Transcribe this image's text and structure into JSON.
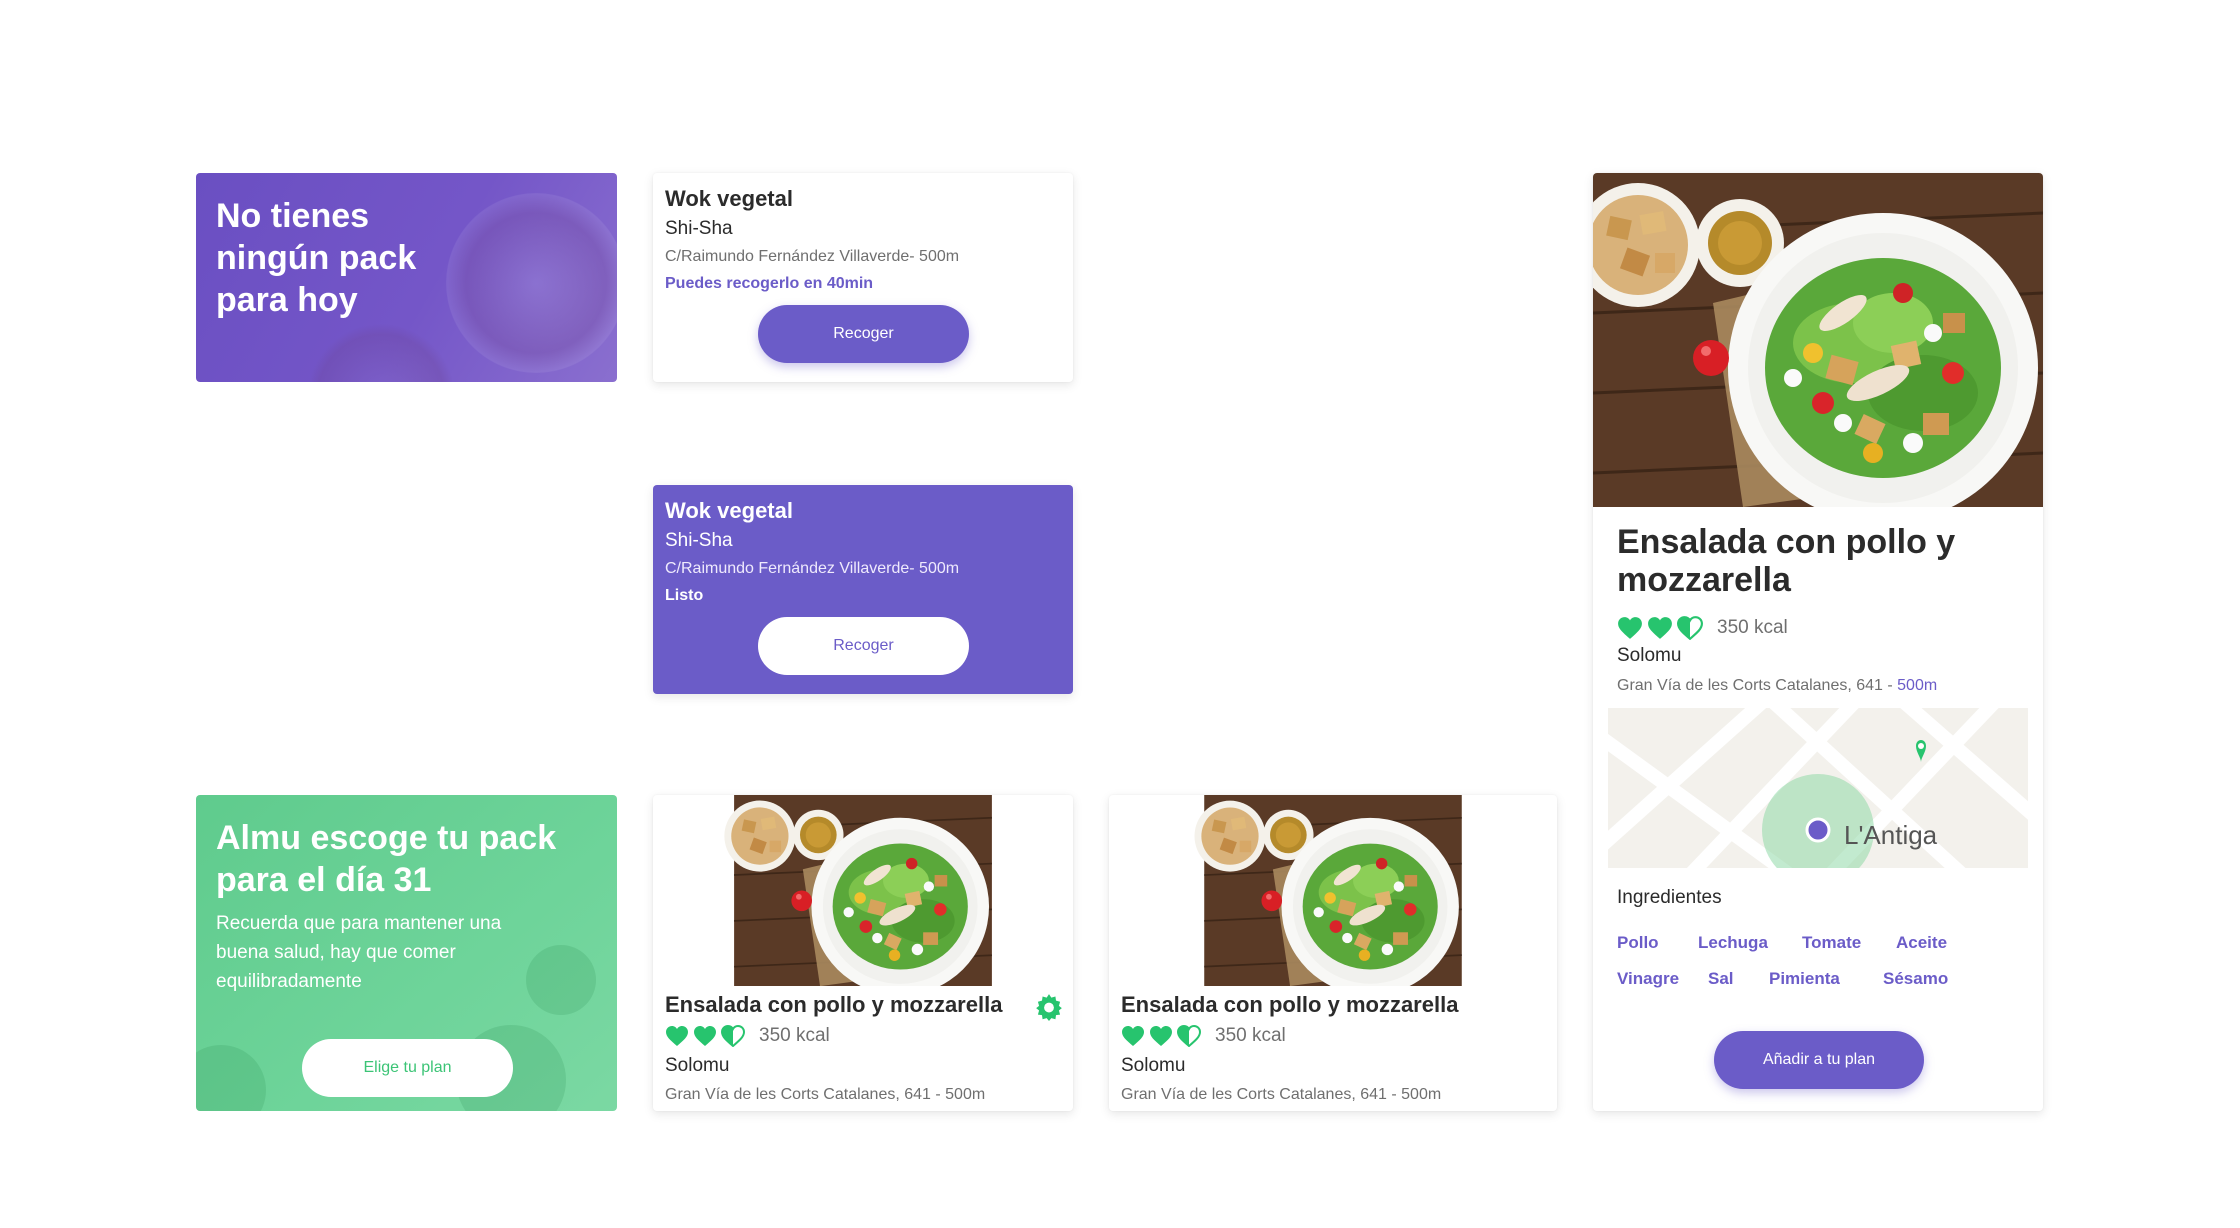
{
  "no_pack_card": {
    "message": "No tienes ningún pack para hoy"
  },
  "order_card_pending": {
    "title": "Wok vegetal",
    "restaurant": "Shi-Sha",
    "address": "C/Raimundo Fernández Villaverde- 500m",
    "status": "Puedes recogerlo en 40min",
    "button_label": "Recoger"
  },
  "order_card_ready": {
    "title": "Wok vegetal",
    "restaurant": "Shi-Sha",
    "address": "C/Raimundo Fernández Villaverde- 500m",
    "status": "Listo",
    "button_label": "Recoger"
  },
  "promo_card": {
    "heading": "Almu escoge tu pack para el día 31",
    "body": "Recuerda que para mantener una buena salud, hay que comer equilibradamente",
    "button_label": "Elige tu plan"
  },
  "dish_card_selected": {
    "name": "Ensalada con pollo y mozzarella",
    "health_rating": 2.5,
    "kcal": "350 kcal",
    "restaurant": "Solomu",
    "address": "Gran Vía de les Corts Catalanes, 641 - 500m",
    "icon": "gear-icon"
  },
  "dish_card": {
    "name": "Ensalada con pollo y mozzarella",
    "health_rating": 2.5,
    "kcal": "350 kcal",
    "restaurant": "Solomu",
    "address": "Gran Vía de les Corts Catalanes, 641 - 500m"
  },
  "dish_detail": {
    "name": "Ensalada con pollo y mozzarella",
    "health_rating": 2.5,
    "kcal": "350 kcal",
    "restaurant": "Solomu",
    "address": "Gran Vía de les Corts Catalanes, 641 -",
    "distance": "500m",
    "map_label": "L'Antiga",
    "ingredients_title": "Ingredientes",
    "ingredients": [
      "Pollo",
      "Lechuga",
      "Tomate",
      "Aceite",
      "Vinagre",
      "Sal",
      "Pimienta",
      "Sésamo"
    ],
    "button_label": "Añadir a tu plan"
  },
  "colors": {
    "brand_purple": "#6b5cc8",
    "brand_green": "#3cc476",
    "heart_green": "#27c46e"
  }
}
